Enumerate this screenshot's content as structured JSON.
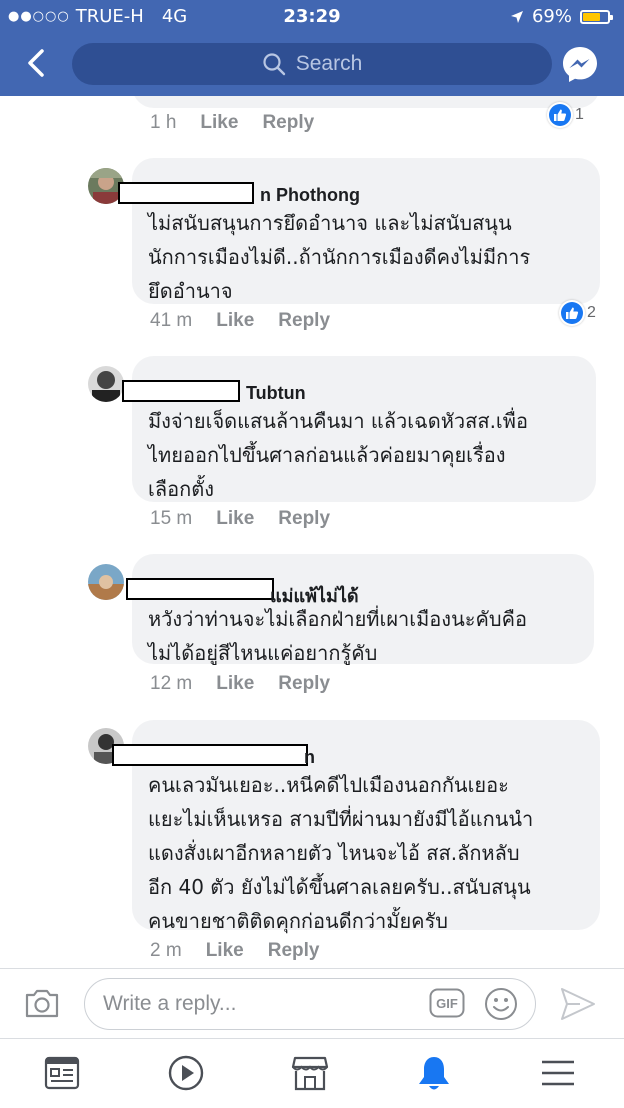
{
  "status_bar": {
    "signal_dots": "●●○○○",
    "carrier": "TRUE-H",
    "network": "4G",
    "time": "23:29",
    "battery": "69%"
  },
  "header": {
    "search_placeholder": "Search"
  },
  "colors": {
    "brand_blue": "#4267b2",
    "search_bg": "#2f4f93",
    "bubble_bg": "#f1f2f4",
    "like_blue": "#1877f2",
    "meta_grey": "#8a8d91"
  },
  "top_meta": {
    "time": "1 h",
    "like": "Like",
    "reply": "Reply",
    "like_count": "1"
  },
  "comments": [
    {
      "name_suffix": "n Phothong",
      "text": "ไม่สนับสนุนการยึดอำนาจ  และไม่สนับสนุน\nนักการเมืองไม่ดี..ถ้านักการเมืองดีคงไม่มีการ\nยึดอำนาจ",
      "time": "41 m",
      "like": "Like",
      "reply": "Reply",
      "like_count": "2"
    },
    {
      "name_suffix": "Tubtun",
      "text": "มึงจ่ายเจ็ดแสนล้านคืนมา แล้วเฉดหัวสส.เพื่อ\nไทยออกไปขึ้นศาลก่อนแล้วค่อยมาคุยเรื่อง\nเลือกตั้ง",
      "time": "15 m",
      "like": "Like",
      "reply": "Reply"
    },
    {
      "name_suffix": "แม่แพ้ไม่ได้",
      "text": "หวังว่าท่านจะไม่เลือกฝ่ายที่เผาเมืองนะคับคือ\nไม่ได้อยู่สีไหนแค่อยากรู้คับ",
      "time": "12 m",
      "like": "Like",
      "reply": "Reply"
    },
    {
      "name_suffix": "n",
      "text": "คนเลวมันเยอะ..หนีคดีไปเมืองนอกกันเยอะ\nแยะไม่เห็นเหรอ สามปีที่ผ่านมายังมีไอ้แกนนำ\nแดงสั่งเผาอีกหลายตัว ไหนจะไอ้ สส.ลักหลับ\nอีก 40 ตัว ยังไม่ได้ขึ้นศาลเลยครับ..สนับสนุน\nคนขายชาติติดคุกก่อนดีกว่ามั้ยครับ",
      "time": "2 m",
      "like": "Like",
      "reply": "Reply"
    }
  ],
  "reply_bar": {
    "placeholder": "Write a reply...",
    "gif_label": "GIF"
  },
  "tabs": [
    "news-feed",
    "watch",
    "marketplace",
    "notifications",
    "menu"
  ]
}
